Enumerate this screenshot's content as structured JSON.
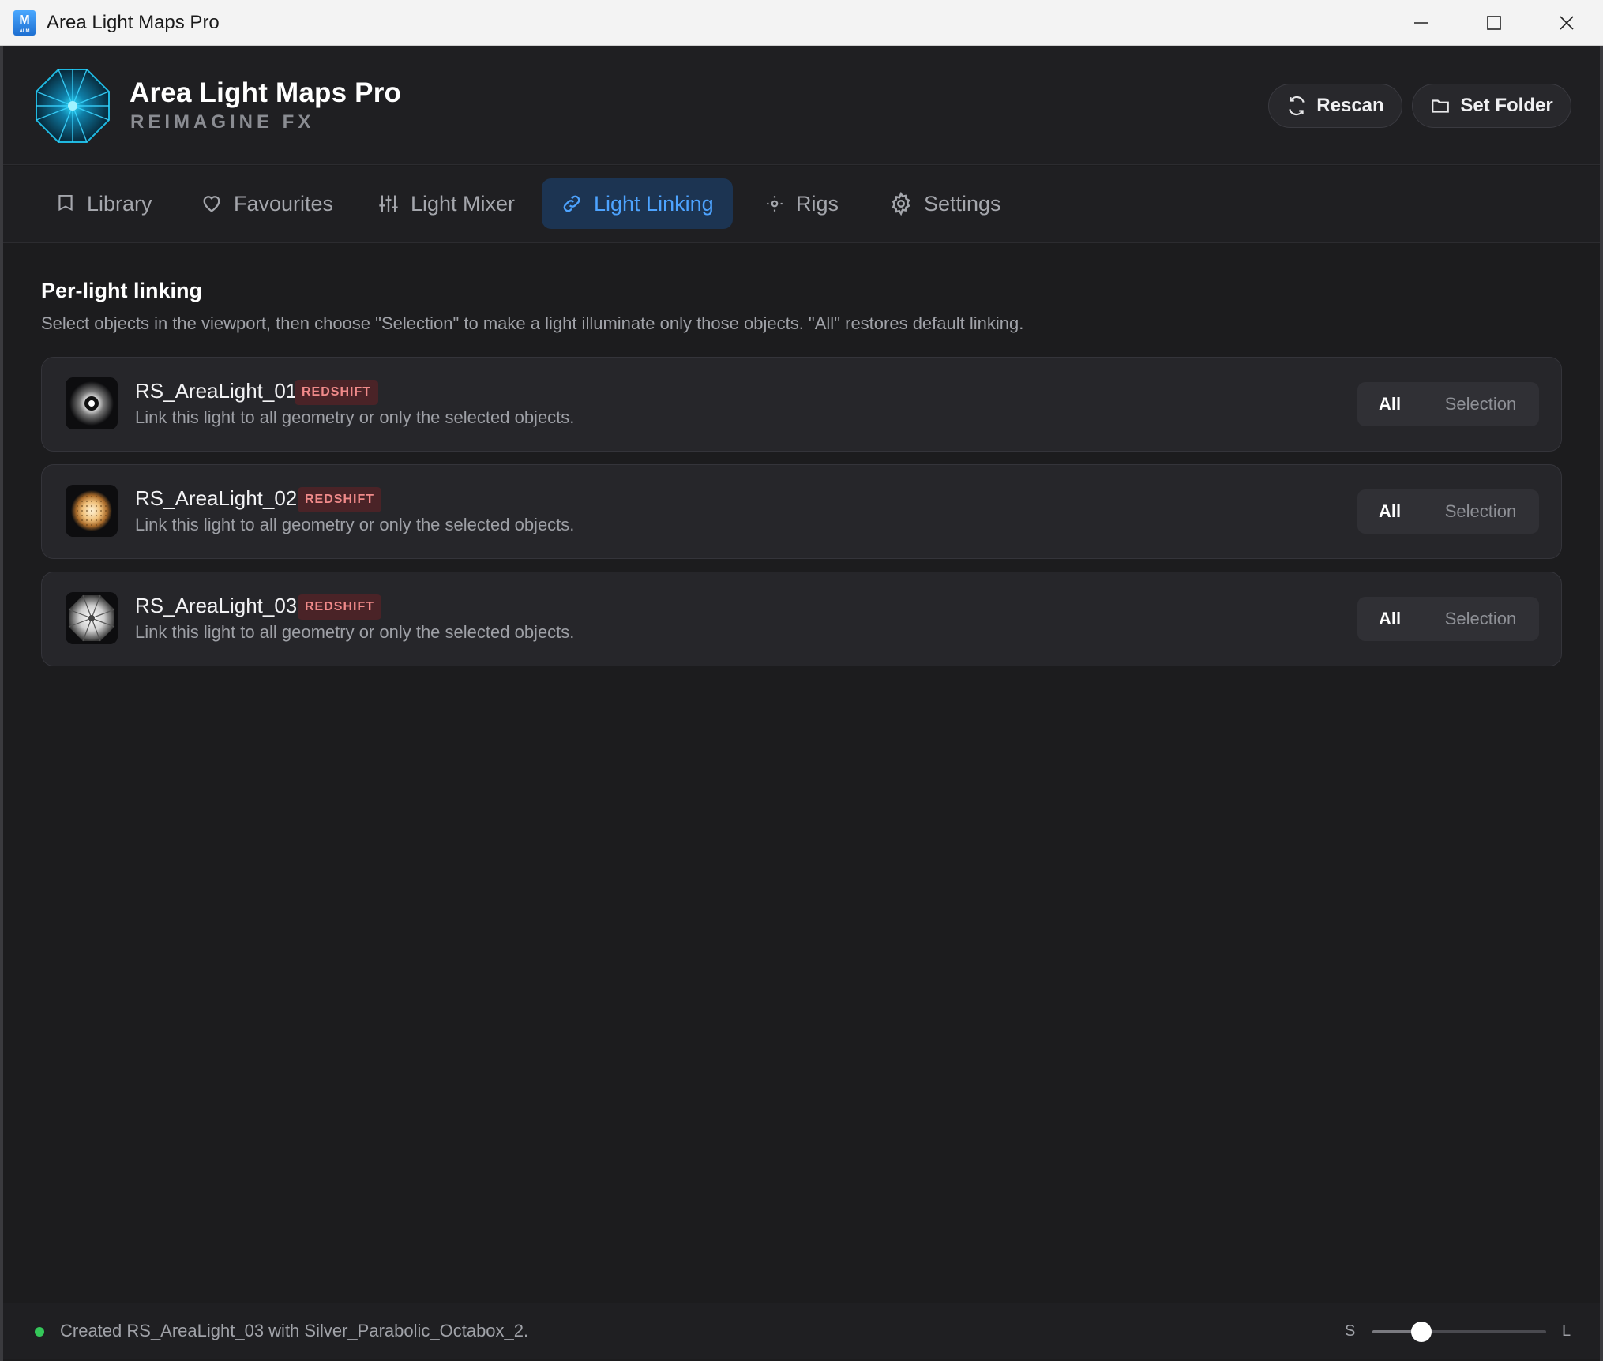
{
  "window": {
    "title": "Area Light Maps Pro",
    "icon_letter": "M",
    "icon_sub": "ALM"
  },
  "header": {
    "app_name": "Area Light Maps Pro",
    "subtitle": "REIMAGINE FX",
    "rescan_label": "Rescan",
    "set_folder_label": "Set Folder"
  },
  "tabs": [
    {
      "label": "Library",
      "icon": "bookmark-icon",
      "active": false
    },
    {
      "label": "Favourites",
      "icon": "heart-icon",
      "active": false
    },
    {
      "label": "Light Mixer",
      "icon": "sliders-icon",
      "active": false
    },
    {
      "label": "Light Linking",
      "icon": "link-icon",
      "active": true
    },
    {
      "label": "Rigs",
      "icon": "sun-icon",
      "active": false
    },
    {
      "label": "Settings",
      "icon": "gear-icon",
      "active": false
    }
  ],
  "section": {
    "title": "Per-light linking",
    "description": "Select objects in the viewport, then choose \"Selection\" to make a light illuminate only those objects. \"All\" restores default linking."
  },
  "lights": [
    {
      "name": "RS_AreaLight_01",
      "badge": "REDSHIFT",
      "description": "Link this light to all geometry or only the selected objects.",
      "option_all": "All",
      "option_selection": "Selection",
      "selected": "All"
    },
    {
      "name": "RS_AreaLight_02",
      "badge": "REDSHIFT",
      "description": "Link this light to all geometry or only the selected objects.",
      "option_all": "All",
      "option_selection": "Selection",
      "selected": "All"
    },
    {
      "name": "RS_AreaLight_03",
      "badge": "REDSHIFT",
      "description": "Link this light to all geometry or only the selected objects.",
      "option_all": "All",
      "option_selection": "Selection",
      "selected": "All"
    }
  ],
  "status": {
    "message": "Created RS_AreaLight_03 with Silver_Parabolic_Octabox_2.",
    "size_small_label": "S",
    "size_large_label": "L",
    "size_value_fraction": 0.28
  },
  "colors": {
    "accent": "#4da3ff",
    "active_tab_bg": "#1c3452",
    "badge_bg": "#4a2327",
    "badge_text": "#f08a8a",
    "status_ok": "#34c759"
  }
}
